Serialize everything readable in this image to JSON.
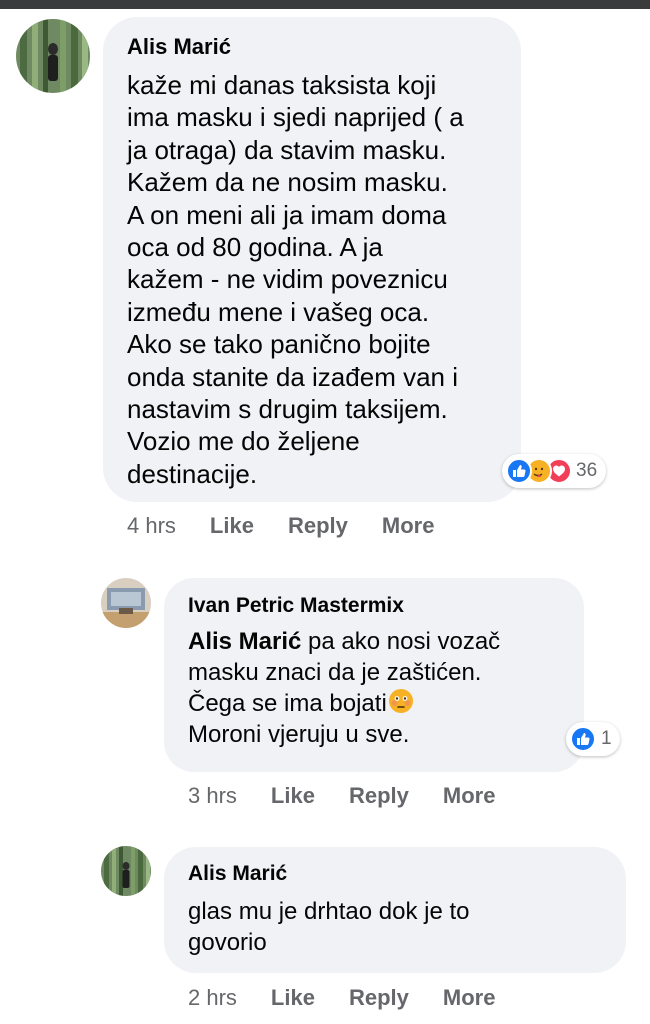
{
  "colors": {
    "bubble": "#f0f2f5",
    "text": "#050505",
    "meta": "#65676b",
    "like_blue": "#1877f2",
    "love_red": "#f33e58",
    "care_yellow": "#f7b125"
  },
  "comments": [
    {
      "author": "Alis Marić",
      "text": "kaže mi danas taksista koji\nima masku i sjedi naprijed ( a\nja otraga) da stavim masku.\nKažem da ne nosim masku.\nA on meni ali ja imam doma\noca od 80 godina. A ja\nkažem - ne vidim poveznicu\nizmeđu mene i vašeg oca.\nAko se tako panično bojite\nonda stanite da izađem van i\nnastavim s drugim taksijem.\nVozio me do željene\ndestinacije.",
      "reactions": {
        "icons": [
          "like-icon",
          "care-icon",
          "love-icon"
        ],
        "count": "36"
      },
      "time": "4 hrs",
      "actions": [
        "Like",
        "Reply",
        "More"
      ]
    },
    {
      "author": "Ivan Petric Mastermix",
      "mention": "Alis Marić",
      "text_after_mention": " pa ako nosi vozač\nmasku znaci da je zaštićen.\nČega se ima bojati",
      "text_after_emoji": "\nMoroni vjeruju u sve.",
      "reactions": {
        "icons": [
          "like-icon"
        ],
        "count": "1"
      },
      "time": "3 hrs",
      "actions": [
        "Like",
        "Reply",
        "More"
      ]
    },
    {
      "author": "Alis Marić",
      "text": "glas mu je drhtao dok je to\ngovorio",
      "time": "2 hrs",
      "actions": [
        "Like",
        "Reply",
        "More"
      ]
    }
  ]
}
